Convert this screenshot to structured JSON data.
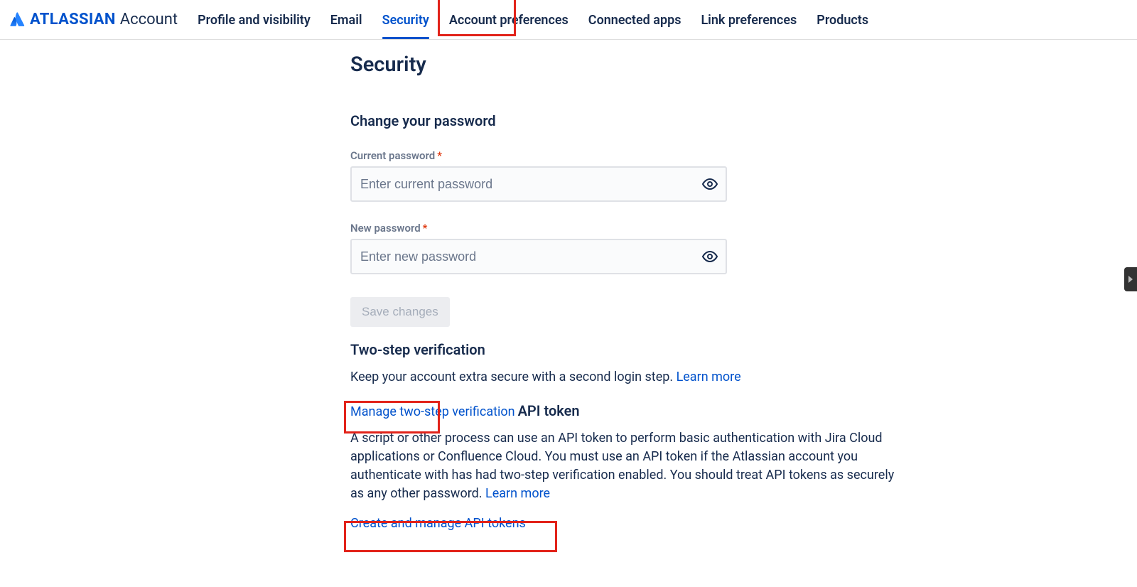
{
  "brand": {
    "strong": "ATLASSIAN",
    "light": "Account"
  },
  "nav": [
    {
      "label": "Profile and visibility",
      "active": false
    },
    {
      "label": "Email",
      "active": false
    },
    {
      "label": "Security",
      "active": true
    },
    {
      "label": "Account preferences",
      "active": false
    },
    {
      "label": "Connected apps",
      "active": false
    },
    {
      "label": "Link preferences",
      "active": false
    },
    {
      "label": "Products",
      "active": false
    }
  ],
  "page": {
    "title": "Security",
    "password_section": {
      "heading": "Change your password",
      "current_label": "Current password",
      "current_placeholder": "Enter current password",
      "new_label": "New password",
      "new_placeholder": "Enter new password",
      "save_label": "Save changes"
    },
    "twostep_section": {
      "heading": "Two-step verification",
      "body": "Keep your account extra secure with a second login step. ",
      "learn_more": "Learn more",
      "manage_link": "Manage two-step verification"
    },
    "api_section": {
      "heading": "API token",
      "body": "A script or other process can use an API token to perform basic authentication with Jira Cloud applications or Confluence Cloud. You must use an API token if the Atlassian account you authenticate with has had two-step verification enabled. You should treat API tokens as securely as any other password. ",
      "learn_more": "Learn more",
      "create_link": "Create and manage API tokens"
    }
  }
}
